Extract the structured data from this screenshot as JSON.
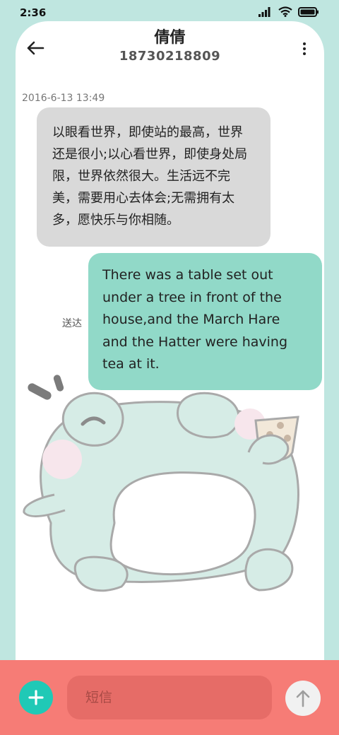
{
  "status_bar": {
    "time": "2:36",
    "icons": [
      "signal-icon",
      "wifi-icon",
      "battery-icon"
    ]
  },
  "header": {
    "back_icon": "arrow-left-icon",
    "contact_name": "倩倩",
    "contact_number": "18730218809",
    "more_icon": "more-vertical-icon"
  },
  "conversation": {
    "timestamp": "2016-6-13 13:49",
    "messages": [
      {
        "direction": "incoming",
        "text": "以眼看世界，即使站的最高，世界还是很小;以心看世界，即使身处局限，世界依然很大。生活远不完美，需要用心去体会;无需拥有太多，愿快乐与你相随。"
      },
      {
        "direction": "outgoing",
        "text": "There was a table set out under a tree in front of the house,and the March Hare and the Hatter were having tea at it.",
        "status": "送达"
      }
    ]
  },
  "composer": {
    "add_icon": "plus-icon",
    "placeholder": "短信",
    "send_icon": "arrow-up-icon"
  },
  "colors": {
    "background": "#bfe6e0",
    "incoming_bubble": "#d9d9d9",
    "outgoing_bubble": "#91d9c8",
    "bottom_bar": "#f67c76",
    "add_button": "#20c9b6"
  }
}
